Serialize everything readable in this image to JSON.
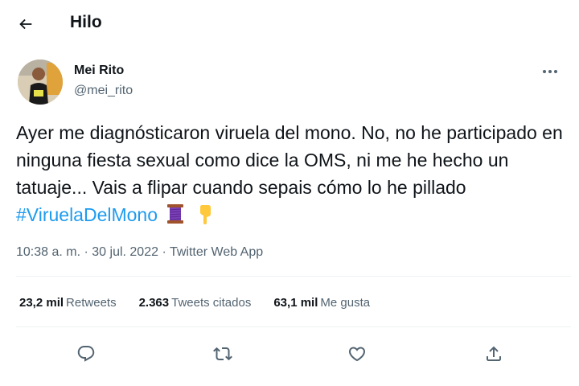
{
  "header": {
    "title": "Hilo"
  },
  "author": {
    "name": "Mei Rito",
    "handle": "@mei_rito"
  },
  "tweet": {
    "text_main": "Ayer me diagnósticaron viruela del mono. No, no he participado en ninguna fiesta sexual como dice la OMS, ni me he hecho un tatuaje... Vais a flipar cuando sepais cómo lo he pillado ",
    "hashtag": "#ViruelaDelMono",
    "emojis": [
      "thread-spool-icon",
      "pointing-down-hand-icon"
    ]
  },
  "meta": {
    "time": "10:38 a. m.",
    "separator1": " · ",
    "date": "30 jul. 2022",
    "separator2": " · ",
    "source": "Twitter Web App"
  },
  "stats": [
    {
      "value": "23,2 mil",
      "label": "Retweets"
    },
    {
      "value": "2.363",
      "label": "Tweets citados"
    },
    {
      "value": "63,1 mil",
      "label": "Me gusta"
    }
  ],
  "colors": {
    "accent": "#1d9bf0",
    "secondary_text": "#536471",
    "divider": "#eff3f4"
  }
}
